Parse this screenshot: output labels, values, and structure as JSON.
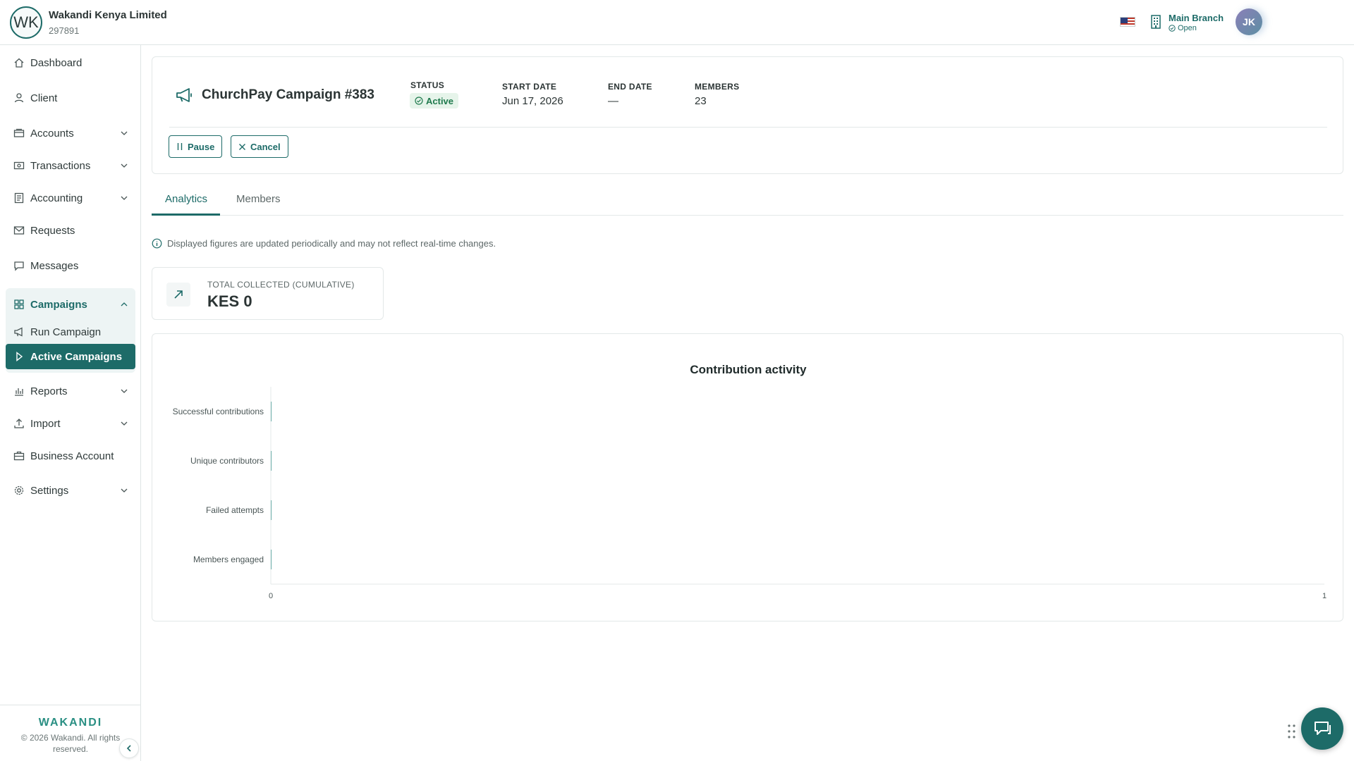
{
  "header": {
    "org_initials": "WK",
    "org_name": "Wakandi Kenya Limited",
    "org_code": "297891",
    "branch_name": "Main Branch",
    "branch_status": "Open",
    "user_initials": "JK"
  },
  "sidebar": {
    "items": [
      {
        "label": "Dashboard"
      },
      {
        "label": "Client"
      },
      {
        "label": "Accounts"
      },
      {
        "label": "Transactions"
      },
      {
        "label": "Accounting"
      },
      {
        "label": "Requests"
      },
      {
        "label": "Messages"
      },
      {
        "label": "Campaigns"
      },
      {
        "label": "Run Campaign"
      },
      {
        "label": "Active Campaigns"
      },
      {
        "label": "Reports"
      },
      {
        "label": "Import"
      },
      {
        "label": "Business Account"
      },
      {
        "label": "Settings"
      }
    ],
    "brand": "WAKANDI",
    "copyright": "© 2026 Wakandi. All rights reserved."
  },
  "campaign": {
    "title": "ChurchPay Campaign #383",
    "status_label": "STATUS",
    "status_value": "Active",
    "start_label": "START DATE",
    "start_value": "Jun 17, 2026",
    "end_label": "END DATE",
    "end_value": "—",
    "members_label": "MEMBERS",
    "members_value": "23",
    "pause_label": "Pause",
    "cancel_label": "Cancel"
  },
  "tabs": [
    {
      "label": "Analytics",
      "active": true
    },
    {
      "label": "Members",
      "active": false
    }
  ],
  "info_note": "Displayed figures are updated periodically and may not reflect real-time changes.",
  "kpi": {
    "label": "TOTAL COLLECTED (CUMULATIVE)",
    "value": "KES 0"
  },
  "colors": {
    "primary": "#1d6b68",
    "success_bg": "#e6f4ea",
    "success_text": "#1f7a4d"
  },
  "chart_data": {
    "type": "bar",
    "orientation": "horizontal",
    "title": "Contribution activity",
    "categories": [
      "Successful contributions",
      "Unique contributors",
      "Failed attempts",
      "Members engaged"
    ],
    "values": [
      0,
      0,
      0,
      0
    ],
    "xlim": [
      0,
      1
    ],
    "x_ticks": [
      "0",
      "1"
    ],
    "grid": false,
    "bar_color": "#7fb8b4"
  }
}
